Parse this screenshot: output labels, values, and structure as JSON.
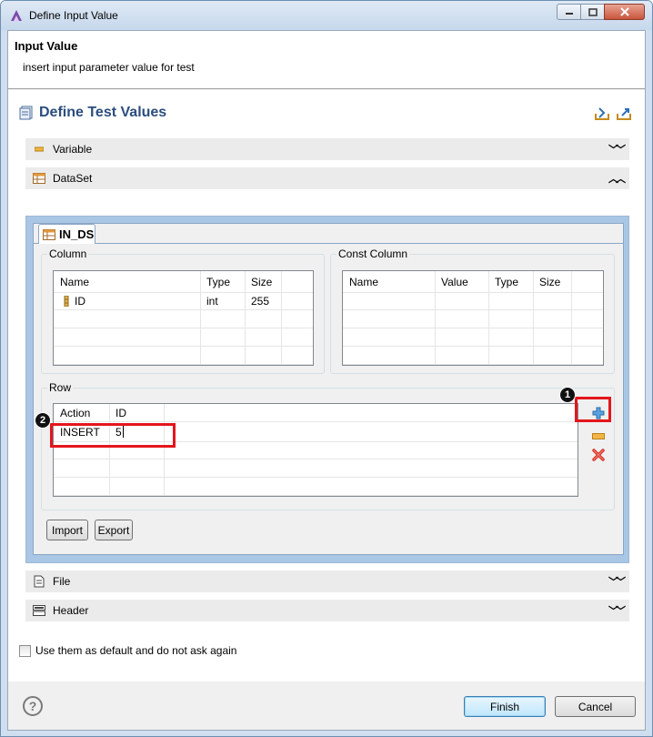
{
  "window": {
    "title": "Define Input Value"
  },
  "header": {
    "title": "Input Value",
    "subtitle": "insert input parameter value for test"
  },
  "page": {
    "title": "Define Test Values"
  },
  "sections": {
    "variable": "Variable",
    "dataset": "DataSet",
    "file": "File",
    "header": "Header"
  },
  "dataset": {
    "tab_label": "IN_DS",
    "column_group": {
      "legend": "Column",
      "headers": [
        "Name",
        "Type",
        "Size"
      ],
      "rows": [
        {
          "name": "ID",
          "type": "int",
          "size": "255"
        }
      ]
    },
    "const_group": {
      "legend": "Const Column",
      "headers": [
        "Name",
        "Value",
        "Type",
        "Size"
      ]
    },
    "row_group": {
      "legend": "Row",
      "headers": [
        "Action",
        "ID"
      ],
      "rows": [
        {
          "action": "INSERT",
          "id": "5"
        }
      ]
    },
    "import_label": "Import",
    "export_label": "Export"
  },
  "annotations": {
    "one": "1",
    "two": "2",
    "color": "#e4161c"
  },
  "icons": {
    "add": "add-row-icon",
    "remove": "remove-row-icon",
    "delete": "delete-all-icon",
    "key": "key-column-icon"
  },
  "options": {
    "default_checkbox_label": "Use them as default and do not ask again",
    "default_checked": false
  },
  "footer": {
    "finish_label": "Finish",
    "cancel_label": "Cancel",
    "help_glyph": "?"
  },
  "colors": {
    "accent": "#2b4d7e",
    "dataset_frame": "#a9c6e4"
  }
}
